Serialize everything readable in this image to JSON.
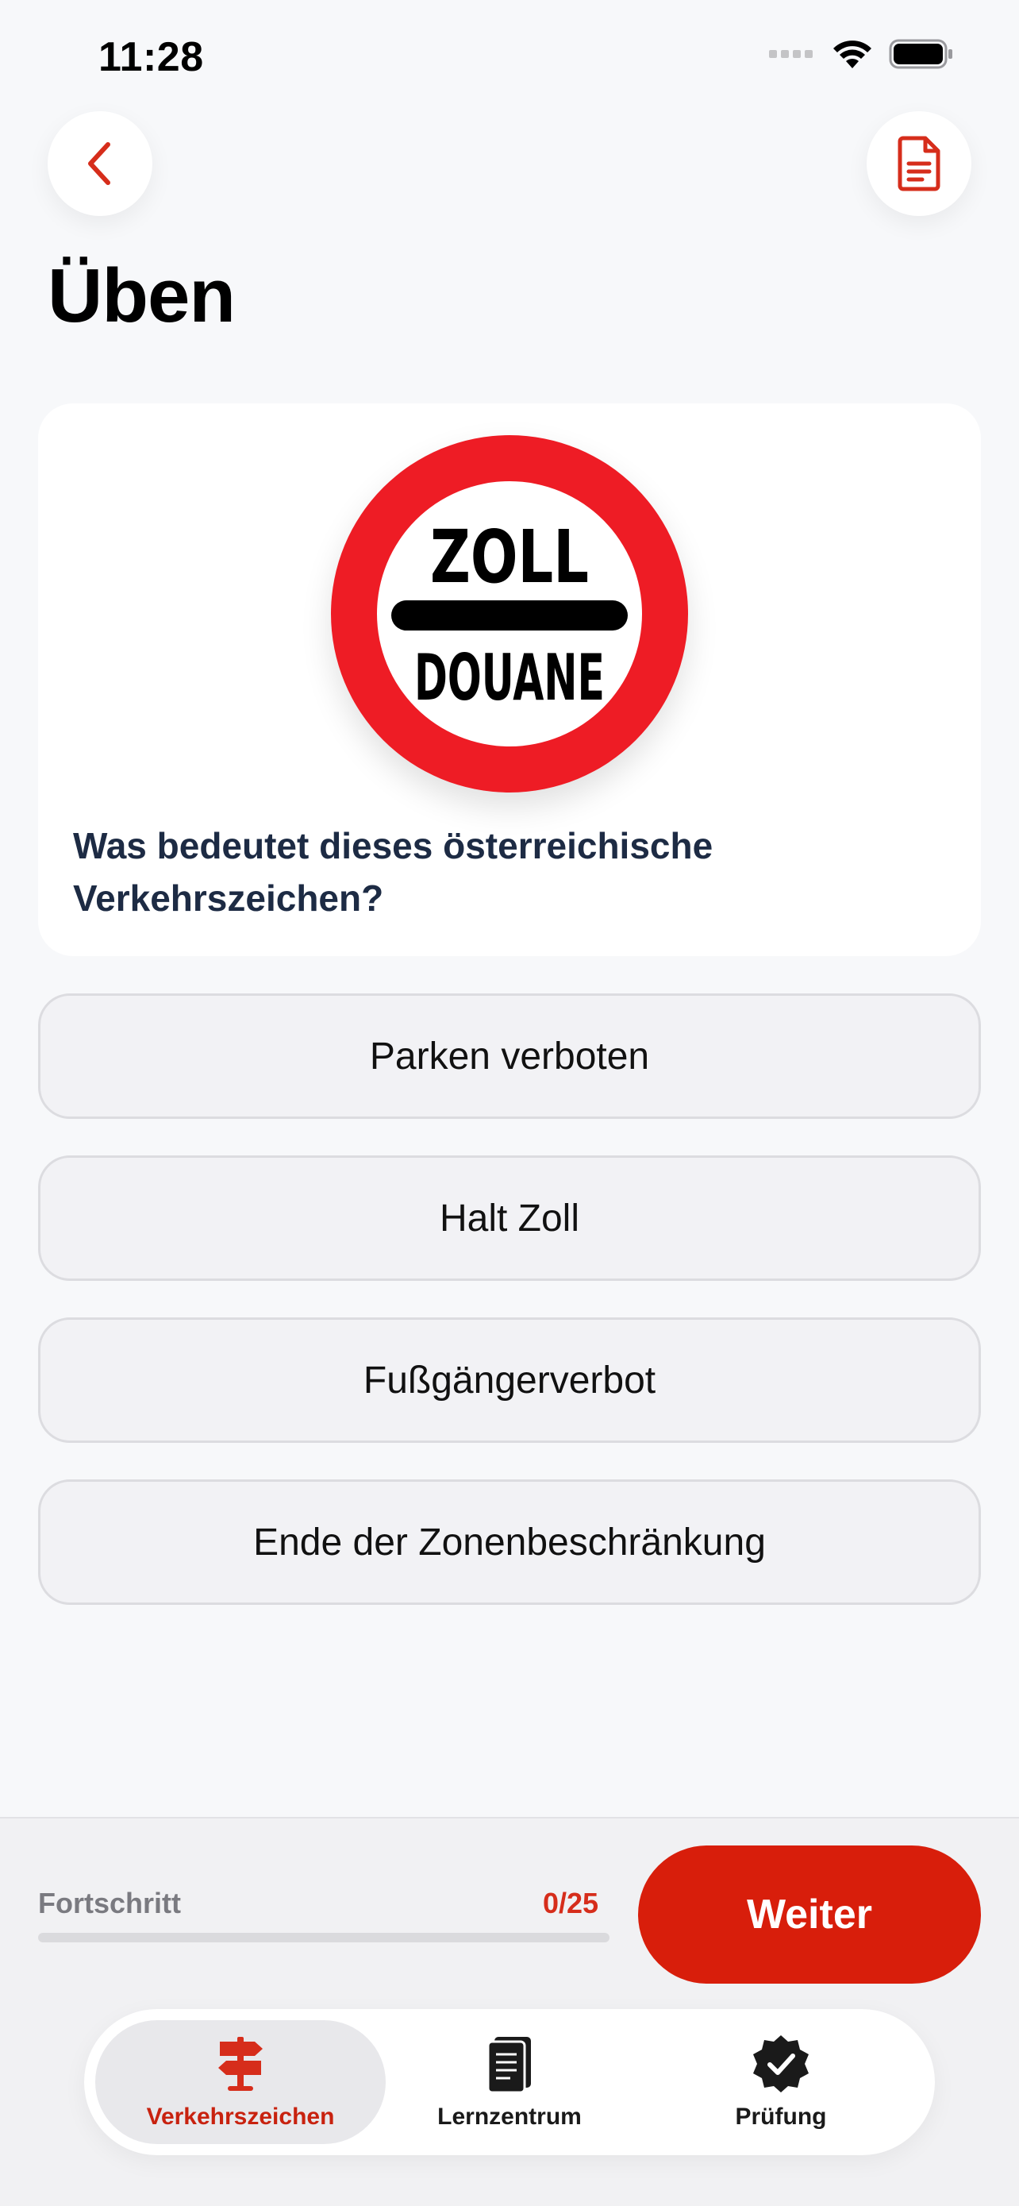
{
  "status_bar": {
    "time": "11:28"
  },
  "header": {
    "title": "Üben"
  },
  "question": {
    "sign_top": "ZOLL",
    "sign_bottom": "DOUANE",
    "text": "Was bedeutet dieses österreichische Verkehrszeichen?"
  },
  "answers": [
    {
      "label": "Parken verboten"
    },
    {
      "label": "Halt Zoll"
    },
    {
      "label": "Fußgängerverbot"
    },
    {
      "label": "Ende der Zonenbeschränkung"
    }
  ],
  "progress": {
    "label": "Fortschritt",
    "count": "0/25",
    "value": 0
  },
  "next_button": {
    "label": "Weiter"
  },
  "tabs": [
    {
      "label": "Verkehrszeichen",
      "icon": "signpost-icon",
      "active": true
    },
    {
      "label": "Lernzentrum",
      "icon": "notebook-icon",
      "active": false
    },
    {
      "label": "Prüfung",
      "icon": "verified-badge-icon",
      "active": false
    }
  ],
  "colors": {
    "accent": "#d81e0b",
    "sign_red": "#ee1c25",
    "question_text": "#1d2b44"
  }
}
